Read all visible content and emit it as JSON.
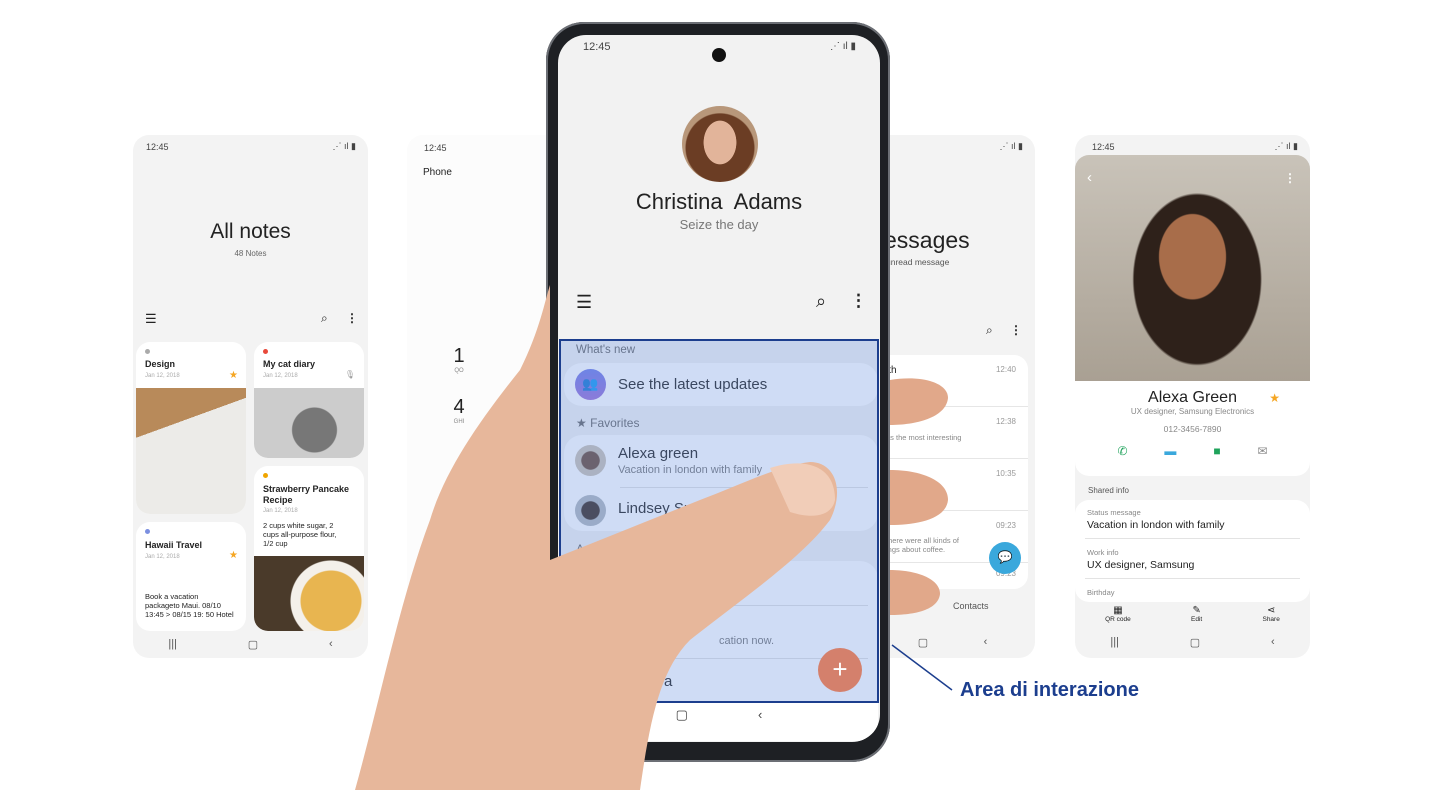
{
  "status_time": "12:45",
  "notes": {
    "title": "All notes",
    "count": "48 Notes",
    "cards": [
      {
        "title": "Design",
        "date": "Jan 12, 2018",
        "dot": "#aaaaaa",
        "starred": true
      },
      {
        "title": "My cat diary",
        "date": "Jan 12, 2018",
        "dot": "#e8493a",
        "mic": true
      },
      {
        "title": "Strawberry Pancake Recipe",
        "date": "Jan 12, 2018",
        "dot": "#f0a500",
        "body": "2 cups white sugar, 2 cups all-purpose flour, 1/2 cup"
      },
      {
        "title": "Hawaii Travel",
        "date": "Jan 12, 2018",
        "dot": "#7b8fe0",
        "starred": true,
        "body": "Book a vacation packageto Maui. 08/10 13:45 > 08/15 19: 50 Hotel"
      }
    ]
  },
  "dialer": {
    "title": "Phone",
    "keys": [
      {
        "digit": "1",
        "sub": "QO"
      },
      {
        "digit": "4",
        "sub": "GHI"
      }
    ]
  },
  "main": {
    "name": "Christina  Adams",
    "status": "Seize the day",
    "whats_new": "What's new",
    "updates": "See the latest updates",
    "favorites": "Favorites",
    "contacts": [
      {
        "name": "Alexa green",
        "sub": "Vacation in london with family"
      },
      {
        "name": "Lindsey Smith",
        "sub": ""
      }
    ],
    "section_a": "A",
    "partial_sub": "cation now.",
    "partial_name": "a",
    "fab_color": "#d4806c"
  },
  "messages": {
    "title": "essages",
    "sub": "unread message",
    "rows": [
      {
        "name": "ith",
        "time": "12:40",
        "preview": ""
      },
      {
        "name": "",
        "time": "12:38",
        "preview": "as the most interesting"
      },
      {
        "name": "",
        "time": "10:35",
        "preview": ""
      },
      {
        "name": "",
        "time": "09:23",
        "preview": "there were all kinds of\nings about coffee."
      },
      {
        "name": "",
        "time": "09:23",
        "preview": ""
      }
    ],
    "tab": "Contacts"
  },
  "contact": {
    "name": "Alexa Green",
    "job": "UX designer, Samsung Electronics",
    "phone": "012-3456-7890",
    "shared": "Shared info",
    "status_label": "Status message",
    "status_value": "Vacation in london with family",
    "work_label": "Work info",
    "work_value": "UX designer, Samsung",
    "birthday_label": "Birthday",
    "actions": [
      "QR code",
      "Edit",
      "Share"
    ]
  },
  "callout": {
    "label": "Area di interazione",
    "color": "#1c3e8e"
  }
}
